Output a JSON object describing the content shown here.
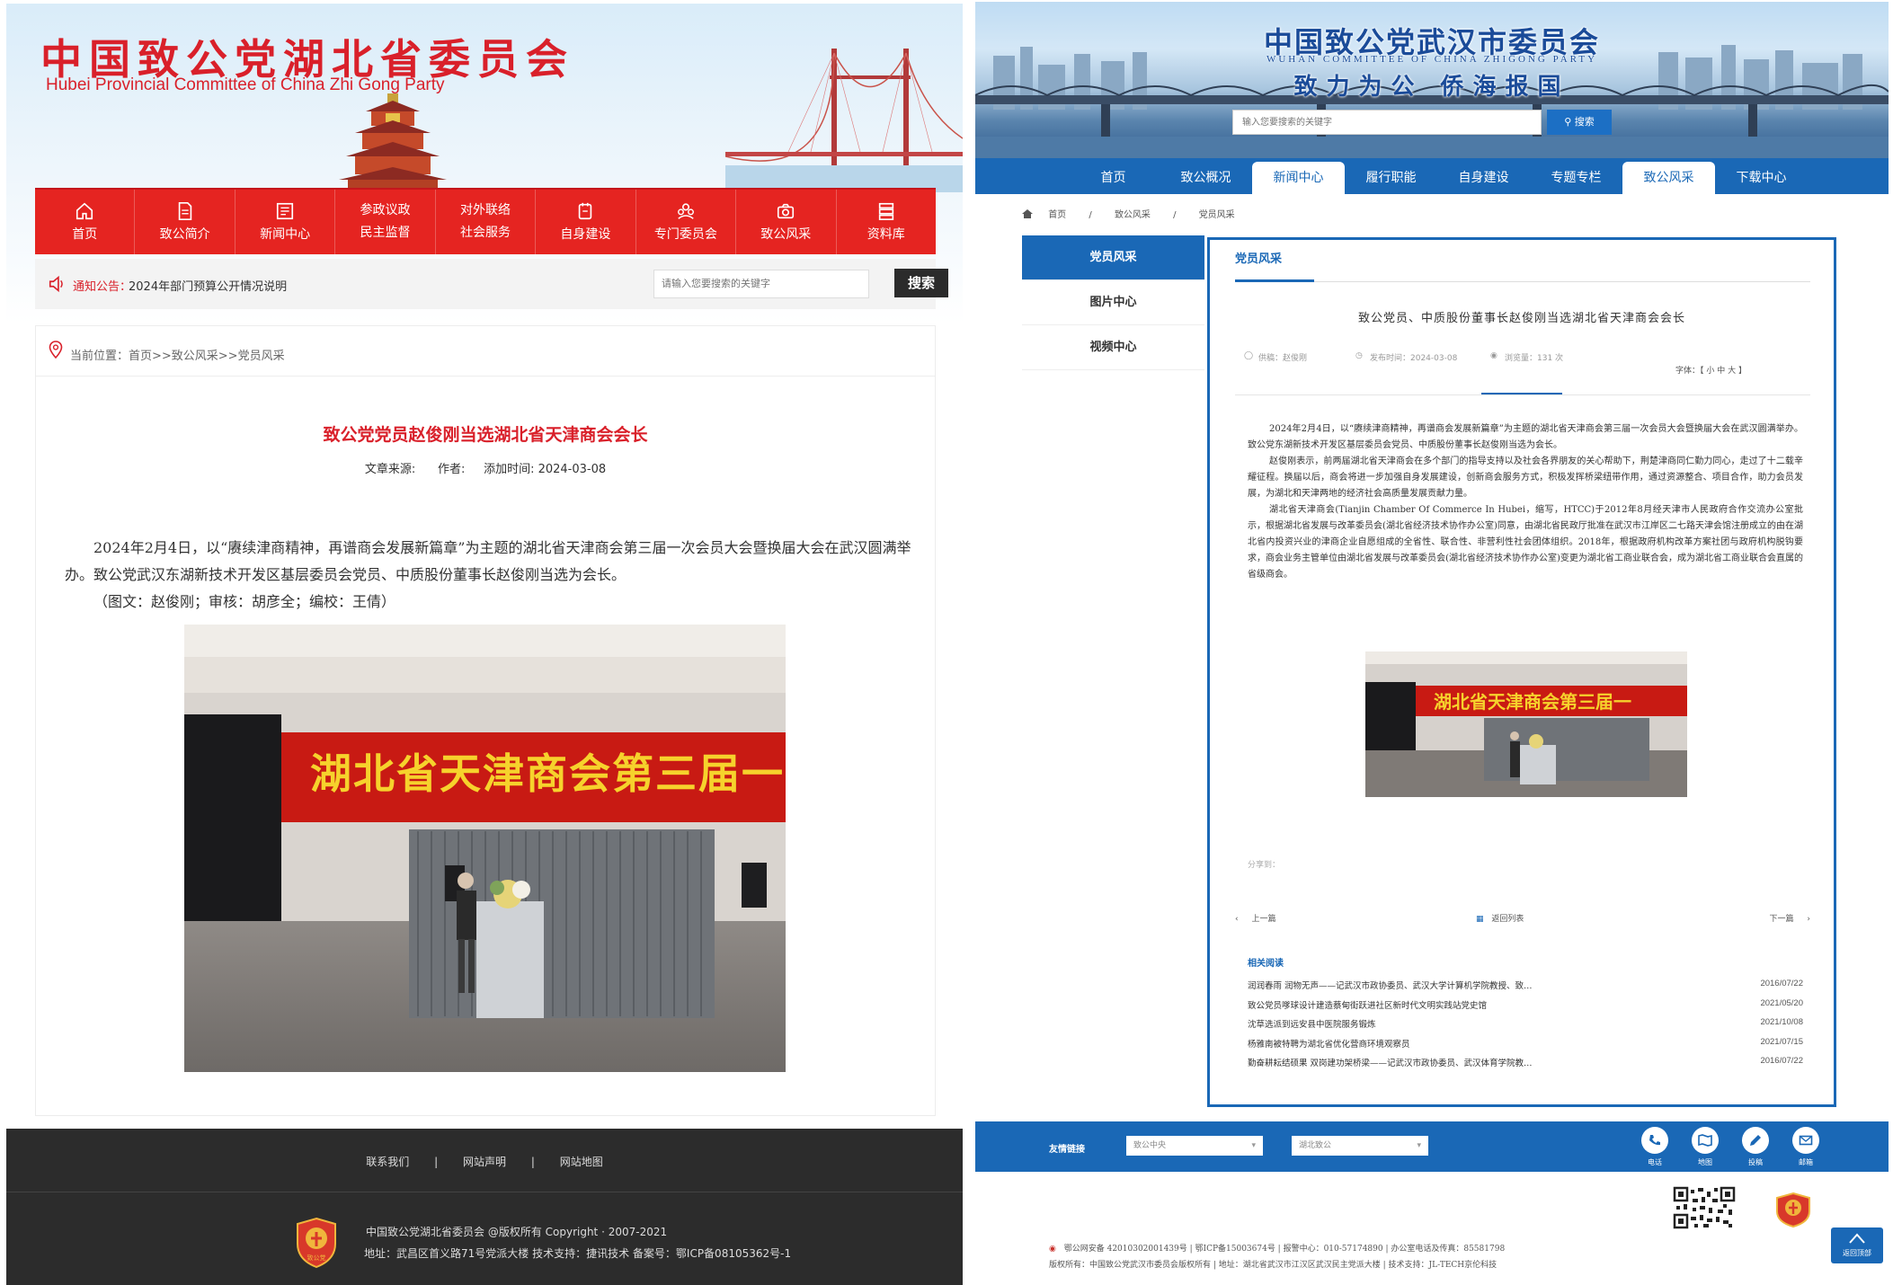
{
  "left": {
    "header": {
      "title": "中国致公党湖北省委员会",
      "subtitle": "Hubei Provincial Committee of China Zhi Gong Party"
    },
    "nav": [
      {
        "line1": "",
        "line2": "首页",
        "icon": "home-icon"
      },
      {
        "line1": "",
        "line2": "致公简介",
        "icon": "document-icon"
      },
      {
        "line1": "",
        "line2": "新闻中心",
        "icon": "news-icon"
      },
      {
        "line1": "参政议政",
        "line2": "民主监督",
        "icon": ""
      },
      {
        "line1": "对外联络",
        "line2": "社会服务",
        "icon": ""
      },
      {
        "line1": "",
        "line2": "自身建设",
        "icon": "building-icon"
      },
      {
        "line1": "",
        "line2": "专门委员会",
        "icon": "group-icon"
      },
      {
        "line1": "",
        "line2": "致公风采",
        "icon": "camera-icon"
      },
      {
        "line1": "",
        "line2": "资料库",
        "icon": "database-icon"
      }
    ],
    "notice": {
      "label": "通知公告：",
      "text": "2024年部门预算公开情况说明"
    },
    "search": {
      "placeholder": "请输入您要搜索的关键字",
      "button": "搜索"
    },
    "breadcrumb": "当前位置：首页>>致公风采>>党员风采",
    "article": {
      "title": "致公党党员赵俊刚当选湖北省天津商会会长",
      "meta": "文章来源:      作者:     添加时间: 2024-03-08",
      "para1": "2024年2月4日，以“赓续津商精神，再谱商会发展新篇章”为主题的湖北省天津商会第三届一次会员大会暨换届大会在武汉圆满举办。致公党武汉东湖新技术开发区基层委员会党员、中质股份董事长赵俊刚当选为会长。",
      "para2": "（图文：赵俊刚；审核：胡彦全；编校：王倩）",
      "photo_banner": "湖北省天津商会第三届一"
    },
    "footer": {
      "links": [
        "联系我们",
        "|",
        "网站声明",
        "|",
        "网站地图"
      ],
      "copyright": "中国致公党湖北省委员会 @版权所有 Copyright · 2007-2021",
      "address": "地址：武昌区首义路71号党派大楼 技术支持：捷讯技术 备案号：鄂ICP备08105362号-1",
      "logo_text": "致公党"
    }
  },
  "right": {
    "header": {
      "title": "中国致公党武汉市委员会",
      "subtitle": "WUHAN COMMITTEE OF CHINA ZHIGONG PARTY",
      "slogan": "致力为公  侨海报国"
    },
    "search": {
      "placeholder": "输入您要搜索的关键字",
      "button": "搜索"
    },
    "nav": [
      {
        "label": "首页",
        "active": false
      },
      {
        "label": "致公概况",
        "active": false
      },
      {
        "label": "新闻中心",
        "active": true
      },
      {
        "label": "履行职能",
        "active": false
      },
      {
        "label": "自身建设",
        "active": false
      },
      {
        "label": "专题专栏",
        "active": false
      },
      {
        "label": "致公风采",
        "active": true
      },
      {
        "label": "下载中心",
        "active": false
      }
    ],
    "breadcrumb": [
      "首页",
      "/",
      "致公风采",
      "/",
      "党员风采"
    ],
    "side": [
      {
        "label": "党员风采",
        "active": true
      },
      {
        "label": "图片中心",
        "active": false
      },
      {
        "label": "视频中心",
        "active": false
      }
    ],
    "main": {
      "tab": "党员风采",
      "title": "致公党员、中质股份董事长赵俊刚当选湖北省天津商会会长",
      "meta": {
        "author": "供稿：赵俊刚",
        "time": "发布时间：2024-03-08",
        "views": "浏览量：131 次",
        "font": "字体：【 小   中   大 】"
      },
      "paragraphs": [
        "2024年2月4日，以“赓续津商精神，再谱商会发展新篇章”为主题的湖北省天津商会第三届一次会员大会暨换届大会在武汉圆满举办。致公党东湖新技术开发区基层委员会党员、中质股份董事长赵俊刚当选为会长。",
        "赵俊刚表示，前两届湖北省天津商会在多个部门的指导支持以及社会各界朋友的关心帮助下，荆楚津商同仁勤力同心，走过了十二载辛耀征程。换届以后，商会将进一步加强自身发展建设，创新商会服务方式，积极发挥桥梁纽带作用，通过资源整合、项目合作，助力会员发展，为湖北和天津两地的经济社会高质量发展贡献力量。",
        "湖北省天津商会(Tianjin Chamber Of Commerce In Hubei，缩写，HTCC)于2012年8月经天津市人民政府合作交流办公室批示，根据湖北省发展与改革委员会(湖北省经济技术协作办公室)同意，由湖北省民政厅批准在武汉市江岸区二七路天津会馆注册成立的由在湖北省内投资兴业的津商企业自愿组成的全省性、联合性、非营利性社会团体组织。2018年，根据政府机构改革方案社团与政府机构脱钩要求，商会业务主管单位由湖北省发展与改革委员会(湖北省经济技术协作办公室)变更为湖北省工商业联合会，成为湖北省工商业联合会直属的省级商会。"
      ],
      "photo_banner": "湖北省天津商会第三届一",
      "share": "分享到：",
      "prev": "上一篇",
      "list": "返回列表",
      "next": "下一篇",
      "related_title": "相关阅读",
      "related": [
        {
          "title": "润润春雨 润物无声——记武汉市政协委员、武汉大学计算机学院教授、致…",
          "date": "2016/07/22"
        },
        {
          "title": "致公党员嗲球设计建造蔡甸街跃进社区新时代文明实践站党史馆",
          "date": "2021/05/20"
        },
        {
          "title": "沈草选派到远安县中医院服务锻炼",
          "date": "2021/10/08"
        },
        {
          "title": "杨雅南被特聘为湖北省优化营商环境观察员",
          "date": "2021/07/15"
        },
        {
          "title": "勤奋耕耘结硕果 双岗建功架桥梁——记武汉市政协委员、武汉体育学院教…",
          "date": "2016/07/22"
        }
      ]
    },
    "friend": {
      "label": "友情链接",
      "select1": "致公中央",
      "select2": "湖北致公",
      "tools": [
        "电话",
        "地图",
        "投稿",
        "邮箱"
      ]
    },
    "footer": {
      "line1": "鄂公网安备 42010302001439号  |  鄂ICP备15003674号  |  报警中心：010-57174890  |  办公室电话及传真：85581798",
      "line2": "版权所有：中国致公党武汉市委员会版权所有  |  地址：湖北省武汉市江汉区武汉民主党派大楼  |  技术支持：JL-TECH京伦科技",
      "backtop": "返回顶部"
    }
  },
  "colors": {
    "left_red": "#e52421",
    "right_blue": "#1a68b6",
    "footer_dark": "#2c2c2c"
  }
}
